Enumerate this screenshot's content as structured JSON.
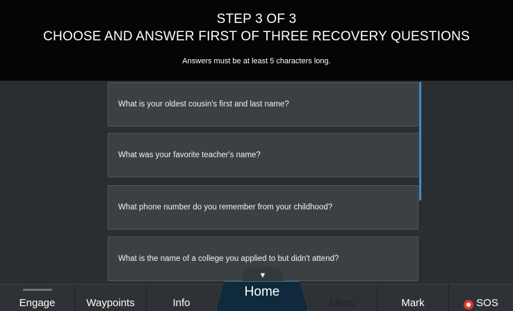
{
  "header": {
    "step": "STEP 3 OF 3",
    "title": "CHOOSE AND ANSWER FIRST OF THREE RECOVERY QUESTIONS",
    "subtitle": "Answers must be at least 5 characters long."
  },
  "questions": [
    "What is your oldest cousin's first and last name?",
    "What was your favorite teacher's name?",
    "What phone number do you remember from your childhood?",
    "What is the name of a college you applied to but didn't attend?"
  ],
  "scroll": {
    "down_arrow": "▼"
  },
  "nav": {
    "engage": "Engage",
    "waypoints": "Waypoints",
    "info": "Info",
    "home": "Home",
    "menu": "Menu",
    "mark": "Mark",
    "sos": "SOS"
  },
  "colors": {
    "accent": "#3d8fd6",
    "sos": "#e2372c",
    "home_tab": "#0e2a3c"
  },
  "icons": {
    "sos": "sos-icon",
    "scroll": "chevron-down-icon"
  }
}
